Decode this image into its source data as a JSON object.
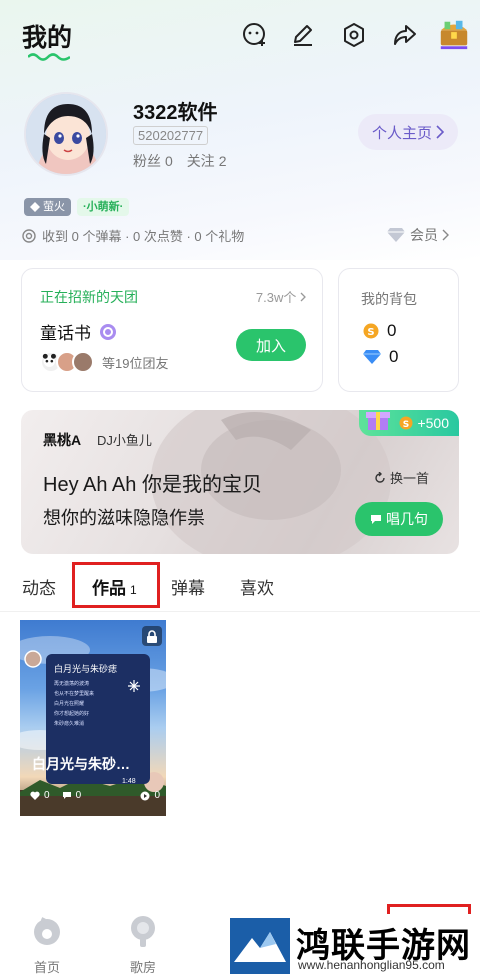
{
  "header": {
    "title": "我的",
    "icons": [
      "chat-add-icon",
      "edit-icon",
      "settings-icon",
      "share-icon",
      "treasure-chest-icon"
    ]
  },
  "profile": {
    "name": "3322软件",
    "id": "520202777",
    "fans_label": "粉丝",
    "fans": "0",
    "following_label": "关注",
    "following": "2",
    "homepage_button": "个人主页"
  },
  "badges": {
    "firefly": "萤火",
    "newbie": "·小萌新·"
  },
  "interactions": {
    "text": "收到 0 个弹幕 · 0 次点赞 · 0 个礼物",
    "member_link": "会员"
  },
  "group_card": {
    "header": "正在招新的天团",
    "count": "7.3w个",
    "name": "童话书",
    "members_text": "等19位团友",
    "join_button": "加入"
  },
  "backpack": {
    "title": "我的背包",
    "coins": "0",
    "diamonds": "0"
  },
  "song_card": {
    "artist": "黑桃A",
    "dj": "DJ小鱼儿",
    "line1": "Hey Ah Ah 你是我的宝贝",
    "line2": "想你的滋味隐隐作祟",
    "reward": "+500",
    "change_song": "换一首",
    "sing_button": "唱几句"
  },
  "tabs": [
    {
      "label": "动态"
    },
    {
      "label": "作品",
      "count": "1",
      "active": true
    },
    {
      "label": "弹幕"
    },
    {
      "label": "喜欢"
    }
  ],
  "work": {
    "inner_title": "白月光与朱砂痣",
    "lyrics": [
      "再无激荡的波涛",
      "也从不在梦里醒来",
      "白月光在照耀",
      "你才想起她的好",
      "朱砂痣久难消"
    ],
    "title": "白月光与朱砂…",
    "time": "1:48",
    "likes": "0",
    "comments": "0",
    "plays": "0"
  },
  "bottom_nav": [
    {
      "label": "首页",
      "icon": "home-icon"
    },
    {
      "label": "歌房",
      "icon": "karaoke-room-icon"
    }
  ],
  "watermark": {
    "text": "鸿联手游网",
    "url": "www.henanhonglian95.com"
  },
  "colors": {
    "accent_green": "#2ac46c",
    "highlight_red": "#e02020",
    "purple": "#6a5bc9"
  }
}
